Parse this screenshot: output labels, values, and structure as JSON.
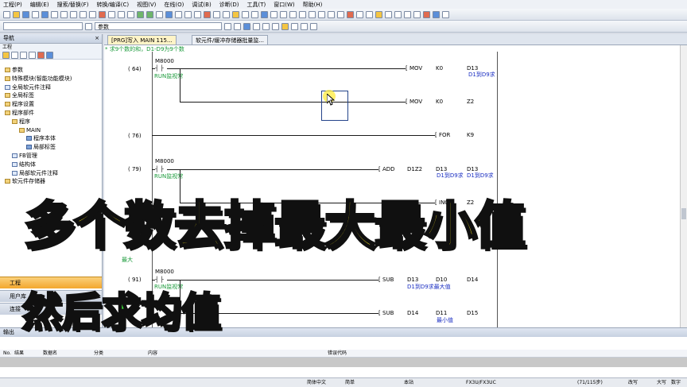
{
  "menu": [
    "工程(P)",
    "编辑(E)",
    "搜索/替换(F)",
    "转换/编译(C)",
    "视图(V)",
    "在线(O)",
    "调试(B)",
    "诊断(D)",
    "工具(T)",
    "窗口(W)",
    "帮助(H)"
  ],
  "toolbar": {
    "combo_value": "参数"
  },
  "navigation": {
    "title": "导航",
    "close": "×",
    "sub_label": "工程",
    "tree": [
      {
        "label": "参数",
        "level": 0,
        "icon": "folder"
      },
      {
        "label": "特殊模块(智能功能模块)",
        "level": 0,
        "icon": "folder"
      },
      {
        "label": "全局软元件注释",
        "level": 0,
        "icon": "doc"
      },
      {
        "label": "全局标签",
        "level": 0,
        "icon": "folder"
      },
      {
        "label": "程序设置",
        "level": 0,
        "icon": "folder"
      },
      {
        "label": "程序部件",
        "level": 0,
        "icon": "folder"
      },
      {
        "label": "程序",
        "level": 1,
        "icon": "folder"
      },
      {
        "label": "MAIN",
        "level": 2,
        "icon": "folder"
      },
      {
        "label": "程序本体",
        "level": 3,
        "icon": "blue"
      },
      {
        "label": "局部标签",
        "level": 3,
        "icon": "blue"
      },
      {
        "label": "FB管理",
        "level": 1,
        "icon": "doc"
      },
      {
        "label": "结构体",
        "level": 1,
        "icon": "doc"
      },
      {
        "label": "局部软元件注释",
        "level": 1,
        "icon": "doc"
      },
      {
        "label": "软元件存储器",
        "level": 0,
        "icon": "folder"
      }
    ],
    "panes": [
      "工程",
      "用户库",
      "连接"
    ]
  },
  "tabs": [
    {
      "label": "[PRG]写入 MAIN 115...",
      "active": true
    },
    {
      "label": "软元件/缓冲存储器批量监...",
      "active": false
    }
  ],
  "ladder": {
    "comment": "* 求9个数的和，D1-D9为9个数",
    "rungs": [
      {
        "step": "(   64)",
        "contact": "M8000",
        "contact_comment": "RUN监视常",
        "instructions": [
          {
            "op": "MOV",
            "a1": "K0",
            "a2": "D13",
            "a2_comment": "D1到D9求"
          },
          {
            "op": "MOV",
            "a1": "K0",
            "a2": "Z2",
            "a2_comment": ""
          }
        ]
      },
      {
        "step": "(   76)",
        "contact": "",
        "contact_comment": "",
        "instructions": [
          {
            "op": "FOR",
            "a1": "K9",
            "a2": "",
            "a2_comment": ""
          }
        ]
      },
      {
        "step": "(   79)",
        "contact": "M8000",
        "contact_comment": "RUN监视常",
        "instructions": [
          {
            "op": "ADD",
            "a1": "D1Z2",
            "a2": "D13",
            "a2_comment": "D1到D9求",
            "a3": "D13",
            "a3_comment": "D1到D9求"
          },
          {
            "op": "INC",
            "a1": "Z2",
            "a2": "",
            "a2_comment": ""
          }
        ]
      },
      {
        "step": "(   91)",
        "contact": "M8000",
        "contact_comment": "RUN监视常",
        "instructions": [
          {
            "op": "SUB",
            "a1": "D13",
            "a2": "D10",
            "a2_comment": "D1到D9求最大值",
            "a3": "D14",
            "a3_comment": ""
          },
          {
            "op": "SUB",
            "a1": "D14",
            "a2": "D11",
            "a2_comment": "最小值",
            "a3": "D15",
            "a3_comment": ""
          }
        ]
      }
    ],
    "partial_label": "最大"
  },
  "output": {
    "title": "输出",
    "columns": [
      "No.",
      "结果",
      "数据名",
      "分类",
      "内容",
      "错误代码"
    ]
  },
  "statusbar": {
    "language": "简体中文",
    "mode": "简单",
    "station": "本站",
    "cpu": "FX3U/FX3UC",
    "step": "(71/115步)",
    "edit": "改写",
    "caps": "大写",
    "num": "数字"
  },
  "overlay": {
    "line1": "多个数去掉最大最小值",
    "line2": "然后求均值"
  }
}
